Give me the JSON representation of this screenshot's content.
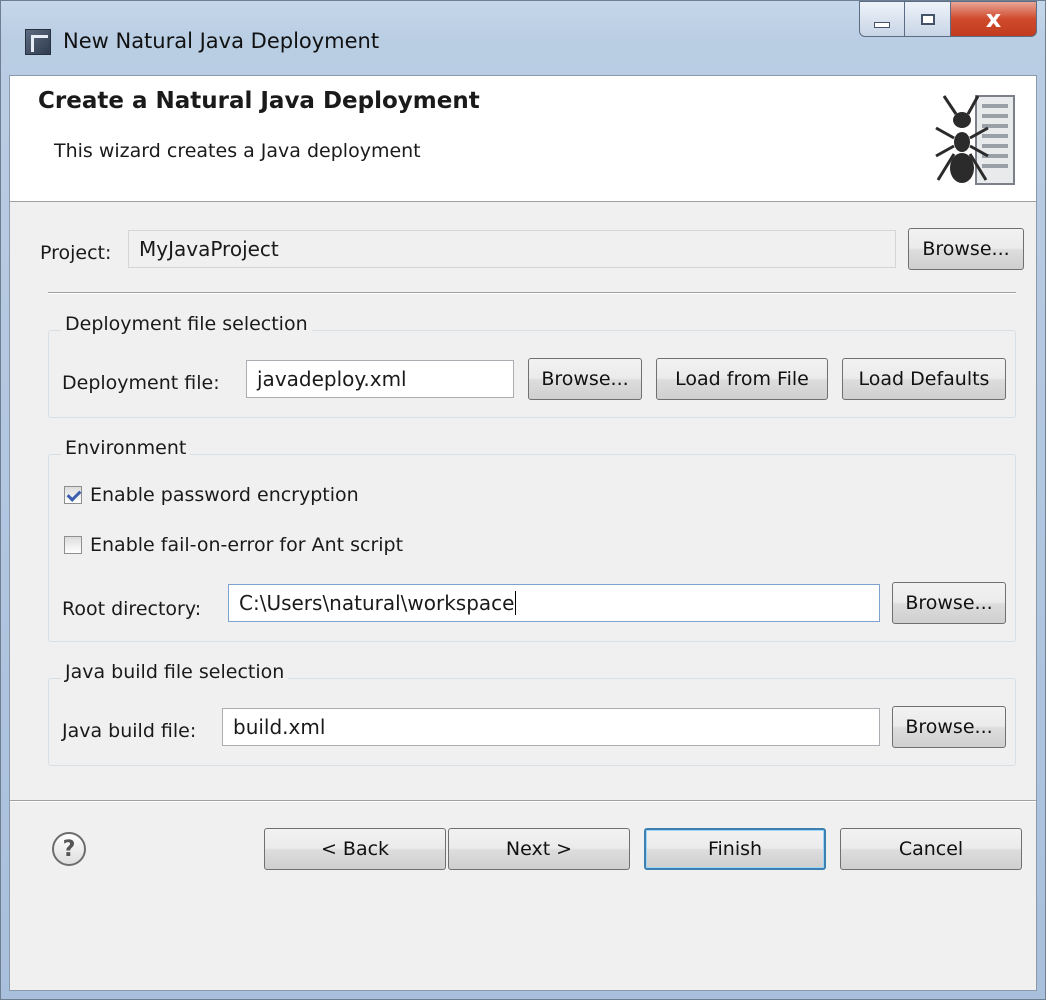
{
  "window": {
    "title": "New Natural Java Deployment",
    "controls": {
      "minimize": "minimize",
      "maximize": "maximize",
      "close": "x"
    }
  },
  "banner": {
    "title": "Create a Natural Java Deployment",
    "subtitle": "This wizard creates a Java deployment",
    "icon": "ant-server-icon"
  },
  "project": {
    "label": "Project:",
    "value": "MyJavaProject",
    "browse_label": "Browse..."
  },
  "deployment_group": {
    "legend": "Deployment file selection",
    "label": "Deployment file:",
    "value": "javadeploy.xml",
    "browse_label": "Browse...",
    "load_from_file_label": "Load from File",
    "load_defaults_label": "Load Defaults"
  },
  "environment_group": {
    "legend": "Environment",
    "password_encryption": {
      "label": "Enable password encryption",
      "checked": true
    },
    "fail_on_error": {
      "label": "Enable fail-on-error for Ant script",
      "checked": false
    },
    "root_label": "Root directory:",
    "root_value": "C:\\Users\\natural\\workspace",
    "browse_label": "Browse..."
  },
  "build_group": {
    "legend": "Java build file selection",
    "label": "Java build file:",
    "value": "build.xml",
    "browse_label": "Browse..."
  },
  "footer": {
    "help": "?",
    "back_label": "< Back",
    "next_label": "Next >",
    "finish_label": "Finish",
    "cancel_label": "Cancel"
  }
}
